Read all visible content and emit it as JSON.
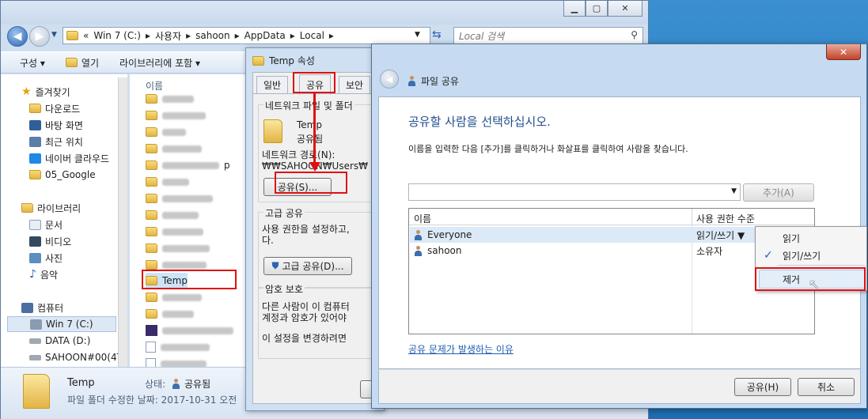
{
  "explorer": {
    "address_segments": [
      "«",
      "Win 7 (C:)",
      "사용자",
      "sahoon",
      "AppData",
      "Local"
    ],
    "search_placeholder": "Local 검색",
    "toolbar": {
      "organize": "구성 ▾",
      "open": "열기",
      "library": "라이브러리에 포함 ▾"
    },
    "nav": {
      "favorites": "즐겨찾기",
      "downloads": "다운로드",
      "desktop": "바탕 화면",
      "recent": "최근 위치",
      "naver": "네이버 클라우드",
      "google": "05_Google",
      "libraries": "라이브러리",
      "documents": "문서",
      "videos": "비디오",
      "pictures": "사진",
      "music": "음악",
      "computer": "컴퓨터",
      "drive_c": "Win 7 (C:)",
      "drive_d": "DATA (D:)",
      "drive_net": "SAHOON#00(4T"
    },
    "column_name": "이름",
    "selected_folder": "Temp",
    "partial_name_suffix": "p",
    "details": {
      "name": "Temp",
      "type_line": "파일 폴더 수정한 날짜: 2017-10-31 오전",
      "status_label": "상태:",
      "status_value": "공유됨"
    }
  },
  "props": {
    "title": "Temp 속성",
    "tabs": [
      "일반",
      "공유",
      "보안"
    ],
    "network_group_label": "네트워크 파일 및 폴더",
    "folder_name": "Temp",
    "folder_status": "공유됨",
    "network_path_label": "네트워크 경로(N):",
    "network_path": "₩₩SAHOON₩Users₩",
    "share_button": "공유(S)...",
    "advanced_group_label": "고급 공유",
    "advanced_text_1": "사용 권한을 설정하고,",
    "advanced_text_2": "다.",
    "advanced_button": "고급 공유(D)...",
    "password_group_label": "암호 보호",
    "password_text_1": "다른 사람이 이 컴퓨터",
    "password_text_2": "계정과 암호가 있어야",
    "password_text_3": "이 설정을 변경하려면"
  },
  "wizard": {
    "title": "파일 공유",
    "heading": "공유할 사람을 선택하십시오.",
    "instruction": "이름을 입력한 다음 [추가]를 클릭하거나 화살표를 클릭하여 사람을 찾습니다.",
    "add_button": "추가(A)",
    "col_name": "이름",
    "col_permission": "사용 권한 수준",
    "rows": [
      {
        "name": "Everyone",
        "permission": "읽기/쓰기 ▼"
      },
      {
        "name": "sahoon",
        "permission": "소유자"
      }
    ],
    "trouble_link": "공유 문제가 발생하는 이유",
    "share_button": "공유(H)",
    "cancel_button": "취소",
    "menu": {
      "read": "읽기",
      "read_write": "읽기/쓰기",
      "remove": "제거",
      "check": "✓"
    }
  }
}
